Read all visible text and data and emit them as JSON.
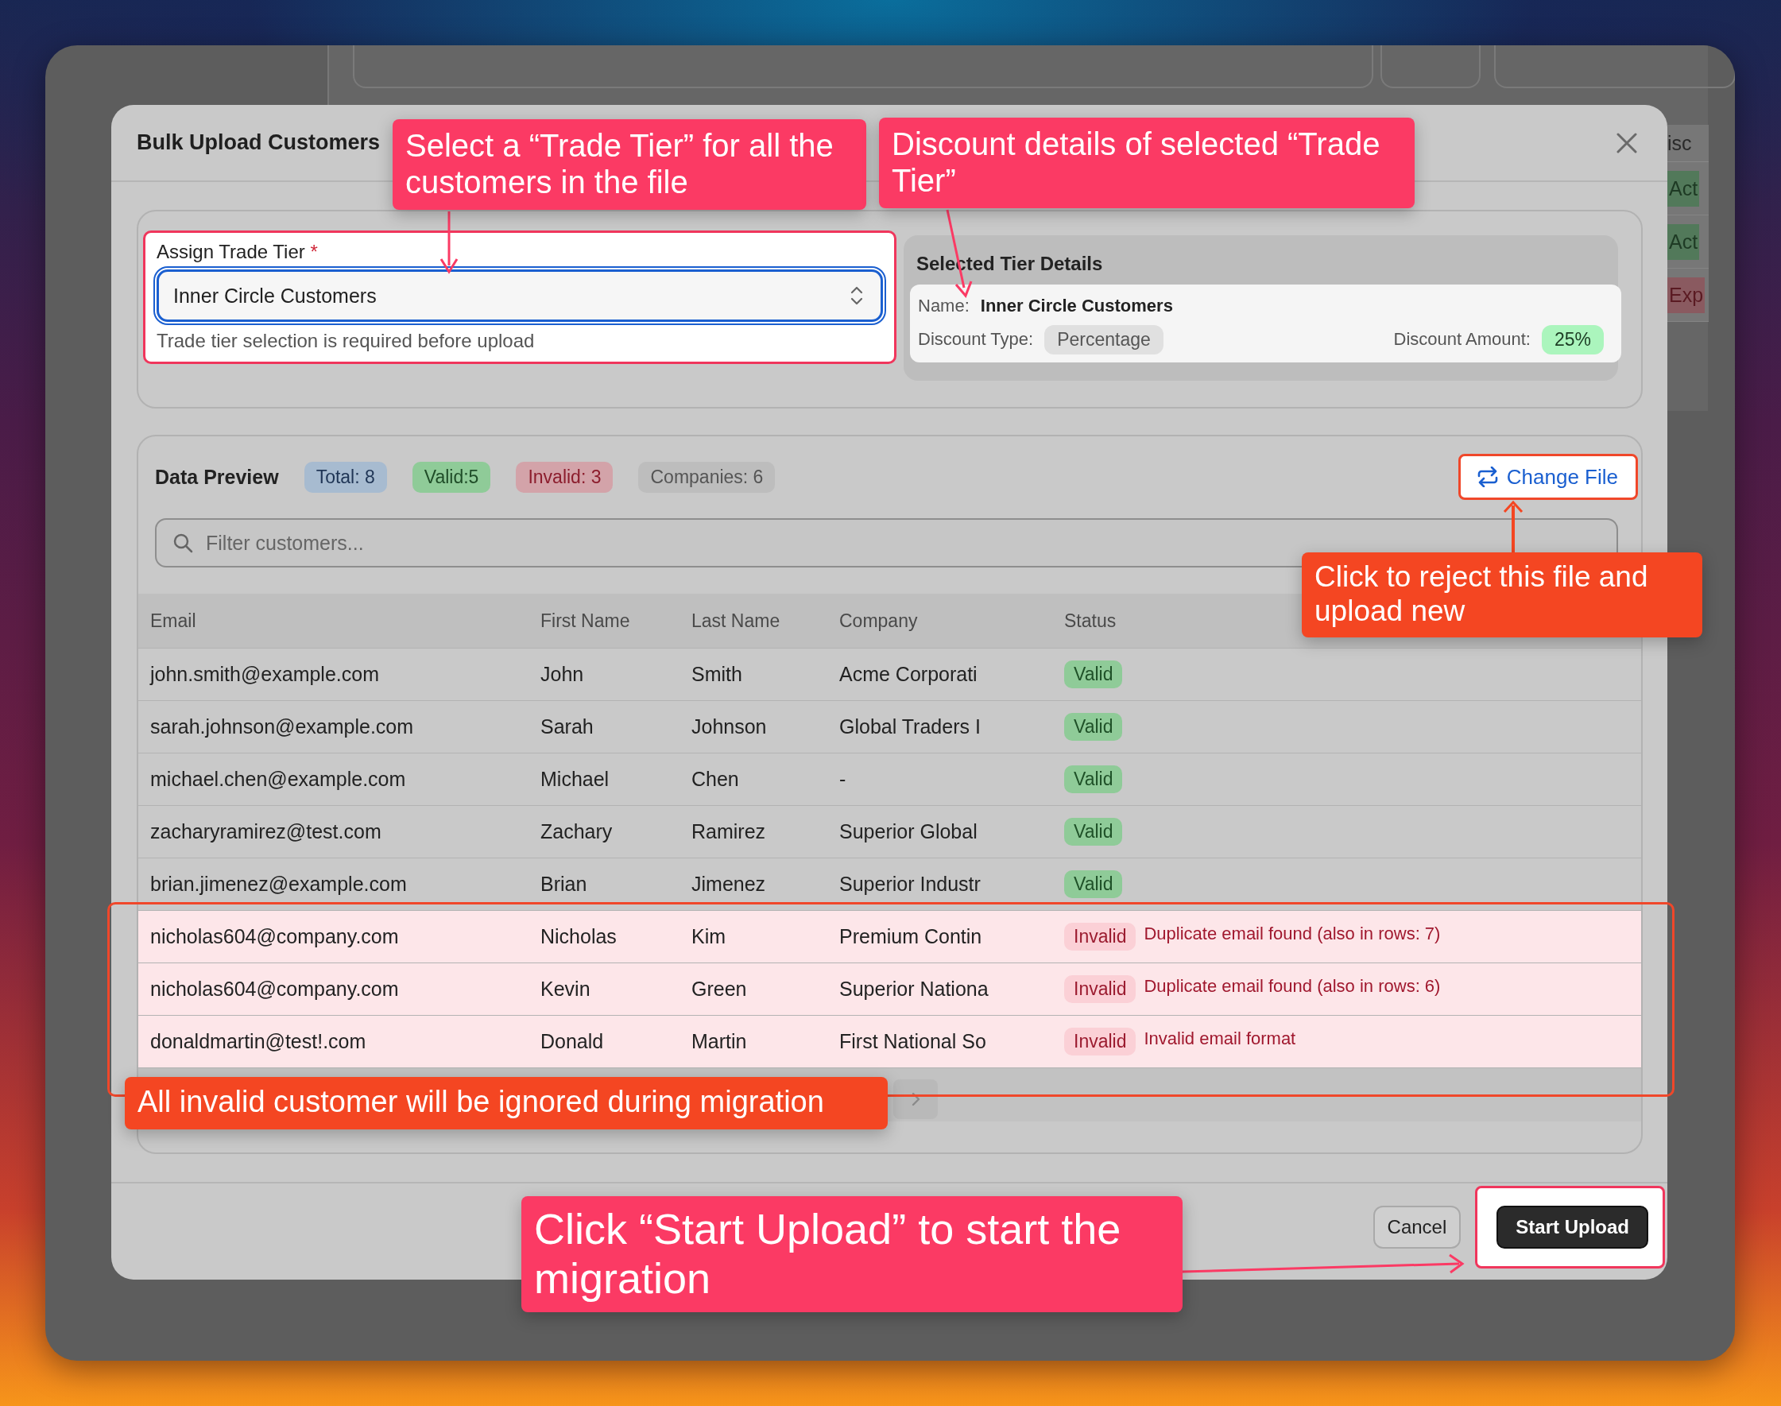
{
  "background": {
    "header_text": "isc",
    "cells": [
      {
        "label": "Act",
        "kind": "active"
      },
      {
        "label": "Act",
        "kind": "active"
      },
      {
        "label": "Exp",
        "kind": "expired"
      }
    ]
  },
  "dialog": {
    "title": "Bulk Upload Customers"
  },
  "tier": {
    "label": "Assign Trade Tier",
    "required_mark": "*",
    "value": "Inner Circle Customers",
    "helper": "Trade tier selection is required before upload"
  },
  "details": {
    "title": "Selected Tier Details",
    "name_label": "Name:",
    "name_value": "Inner Circle Customers",
    "type_label": "Discount Type:",
    "type_value": "Percentage",
    "amount_label": "Discount Amount:",
    "amount_value": "25%"
  },
  "preview": {
    "title": "Data Preview",
    "badges": [
      {
        "label": "Total: 8",
        "kind": "total"
      },
      {
        "label": "Valid:5",
        "kind": "valid"
      },
      {
        "label": "Invalid: 3",
        "kind": "invalid"
      },
      {
        "label": "Companies: 6",
        "kind": "neutral"
      }
    ],
    "change_file": "Change File",
    "filter_placeholder": "Filter customers...",
    "columns": [
      "Email",
      "First Name",
      "Last Name",
      "Company",
      "Status"
    ],
    "rows": [
      {
        "email": "john.smith@example.com",
        "first_name": "John",
        "last_name": "Smith",
        "company": "Acme Corporati",
        "status": "Valid",
        "kind": "valid"
      },
      {
        "email": "sarah.johnson@example.com",
        "first_name": "Sarah",
        "last_name": "Johnson",
        "company": "Global Traders I",
        "status": "Valid",
        "kind": "valid"
      },
      {
        "email": "michael.chen@example.com",
        "first_name": "Michael",
        "last_name": "Chen",
        "company": "-",
        "status": "Valid",
        "kind": "valid"
      },
      {
        "email": "zacharyramirez@test.com",
        "first_name": "Zachary",
        "last_name": "Ramirez",
        "company": "Superior Global",
        "status": "Valid",
        "kind": "valid"
      },
      {
        "email": "brian.jimenez@example.com",
        "first_name": "Brian",
        "last_name": "Jimenez",
        "company": "Superior Industr",
        "status": "Valid",
        "kind": "valid"
      },
      {
        "email": "nicholas604@company.com",
        "first_name": "Nicholas",
        "last_name": "Kim",
        "company": "Premium Contin",
        "status": "Invalid",
        "kind": "invalid",
        "message": "Duplicate email found (also in rows: 7)"
      },
      {
        "email": "nicholas604@company.com",
        "first_name": "Kevin",
        "last_name": "Green",
        "company": "Superior Nationa",
        "status": "Invalid",
        "kind": "invalid",
        "message": "Duplicate email found (also in rows: 6)"
      },
      {
        "email": "donaldmartin@test!.com",
        "first_name": "Donald",
        "last_name": "Martin",
        "company": "First National So",
        "status": "Invalid",
        "kind": "invalid",
        "message": "Invalid email format"
      }
    ]
  },
  "footer": {
    "cancel": "Cancel",
    "primary": "Start Upload"
  },
  "annotations": [
    {
      "text": "Select a “Trade Tier” for all the customers in the file",
      "color": "#fb3a64"
    },
    {
      "text": "Discount details of selected “Trade Tier”",
      "color": "#fb3a64"
    },
    {
      "text": "Click to reject this file and upload new",
      "color": "#f44622"
    },
    {
      "text": "All invalid customer will be ignored during migration",
      "color": "#f44622"
    },
    {
      "text": "Click “Start Upload” to start the migration",
      "color": "#fb3a64"
    }
  ]
}
